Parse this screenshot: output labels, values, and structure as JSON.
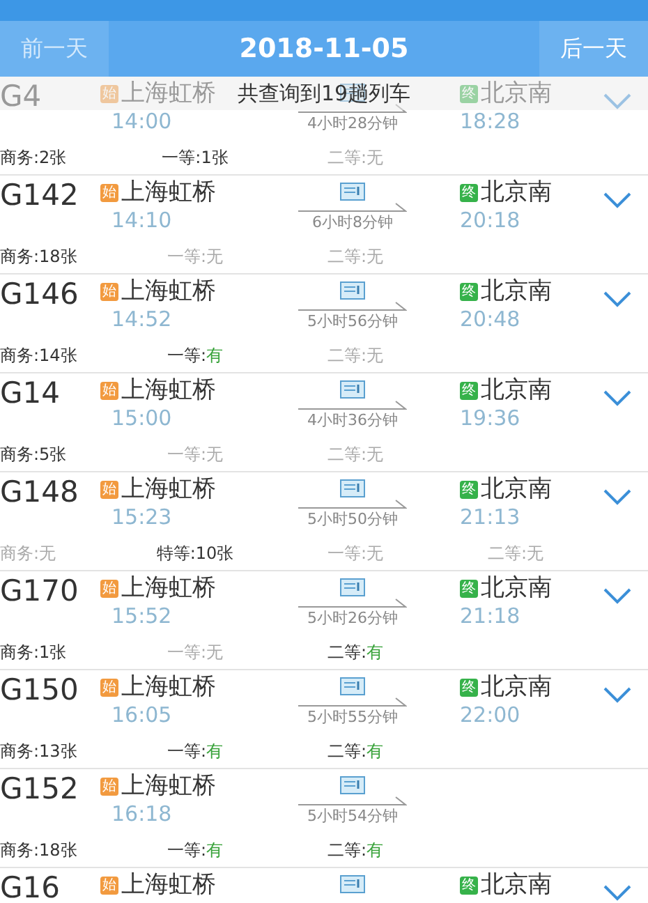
{
  "header": {
    "prev_label": "前一天",
    "prev_disabled": true,
    "date": "2018-11-05",
    "next_label": "后一天",
    "next_disabled": false
  },
  "toast": "共查询到19趟列车",
  "trains": [
    {
      "number": "G4",
      "dep_badge": "始",
      "dep_station": "上海虹桥",
      "dep_time": "14:00",
      "duration": "4小时28分钟",
      "arr_badge": "终",
      "arr_station": "北京南",
      "arr_time": "18:28",
      "expandable": true,
      "seats": [
        {
          "label": "商务:",
          "value": "2张",
          "available": true,
          "highlighted": false
        },
        {
          "label": "一等:",
          "value": "1张",
          "available": true,
          "highlighted": false
        },
        {
          "label": "二等:",
          "value": "无",
          "available": false,
          "highlighted": false
        }
      ]
    },
    {
      "number": "G142",
      "dep_badge": "始",
      "dep_station": "上海虹桥",
      "dep_time": "14:10",
      "duration": "6小时8分钟",
      "arr_badge": "终",
      "arr_station": "北京南",
      "arr_time": "20:18",
      "expandable": true,
      "seats": [
        {
          "label": "商务:",
          "value": "18张",
          "available": true,
          "highlighted": false
        },
        {
          "label": "一等:",
          "value": "无",
          "available": false,
          "highlighted": false
        },
        {
          "label": "二等:",
          "value": "无",
          "available": false,
          "highlighted": false
        }
      ]
    },
    {
      "number": "G146",
      "dep_badge": "始",
      "dep_station": "上海虹桥",
      "dep_time": "14:52",
      "duration": "5小时56分钟",
      "arr_badge": "终",
      "arr_station": "北京南",
      "arr_time": "20:48",
      "expandable": true,
      "seats": [
        {
          "label": "商务:",
          "value": "14张",
          "available": true,
          "highlighted": false
        },
        {
          "label": "一等:",
          "value": "有",
          "available": true,
          "highlighted": true
        },
        {
          "label": "二等:",
          "value": "无",
          "available": false,
          "highlighted": false
        }
      ]
    },
    {
      "number": "G14",
      "dep_badge": "始",
      "dep_station": "上海虹桥",
      "dep_time": "15:00",
      "duration": "4小时36分钟",
      "arr_badge": "终",
      "arr_station": "北京南",
      "arr_time": "19:36",
      "expandable": true,
      "seats": [
        {
          "label": "商务:",
          "value": "5张",
          "available": true,
          "highlighted": false
        },
        {
          "label": "一等:",
          "value": "无",
          "available": false,
          "highlighted": false
        },
        {
          "label": "二等:",
          "value": "无",
          "available": false,
          "highlighted": false
        }
      ]
    },
    {
      "number": "G148",
      "dep_badge": "始",
      "dep_station": "上海虹桥",
      "dep_time": "15:23",
      "duration": "5小时50分钟",
      "arr_badge": "终",
      "arr_station": "北京南",
      "arr_time": "21:13",
      "expandable": true,
      "seats": [
        {
          "label": "商务:",
          "value": "无",
          "available": false,
          "highlighted": false
        },
        {
          "label": "特等:",
          "value": "10张",
          "available": true,
          "highlighted": false
        },
        {
          "label": "一等:",
          "value": "无",
          "available": false,
          "highlighted": false
        },
        {
          "label": "二等:",
          "value": "无",
          "available": false,
          "highlighted": false
        }
      ]
    },
    {
      "number": "G170",
      "dep_badge": "始",
      "dep_station": "上海虹桥",
      "dep_time": "15:52",
      "duration": "5小时26分钟",
      "arr_badge": "终",
      "arr_station": "北京南",
      "arr_time": "21:18",
      "expandable": true,
      "seats": [
        {
          "label": "商务:",
          "value": "1张",
          "available": true,
          "highlighted": false
        },
        {
          "label": "一等:",
          "value": "无",
          "available": false,
          "highlighted": false
        },
        {
          "label": "二等:",
          "value": "有",
          "available": true,
          "highlighted": true
        }
      ]
    },
    {
      "number": "G150",
      "dep_badge": "始",
      "dep_station": "上海虹桥",
      "dep_time": "16:05",
      "duration": "5小时55分钟",
      "arr_badge": "终",
      "arr_station": "北京南",
      "arr_time": "22:00",
      "expandable": true,
      "seats": [
        {
          "label": "商务:",
          "value": "13张",
          "available": true,
          "highlighted": false
        },
        {
          "label": "一等:",
          "value": "有",
          "available": true,
          "highlighted": true
        },
        {
          "label": "二等:",
          "value": "有",
          "available": true,
          "highlighted": true
        }
      ]
    },
    {
      "number": "G152",
      "dep_badge": "始",
      "dep_station": "上海虹桥",
      "dep_time": "16:18",
      "duration": "5小时54分钟",
      "expandable": false,
      "seats": [
        {
          "label": "商务:",
          "value": "18张",
          "available": true,
          "highlighted": false
        },
        {
          "label": "一等:",
          "value": "有",
          "available": true,
          "highlighted": true
        },
        {
          "label": "二等:",
          "value": "有",
          "available": true,
          "highlighted": true
        }
      ]
    },
    {
      "number": "G16",
      "dep_badge": "始",
      "dep_station": "上海虹桥",
      "arr_badge": "终",
      "arr_station": "北京南",
      "expandable": true
    }
  ]
}
